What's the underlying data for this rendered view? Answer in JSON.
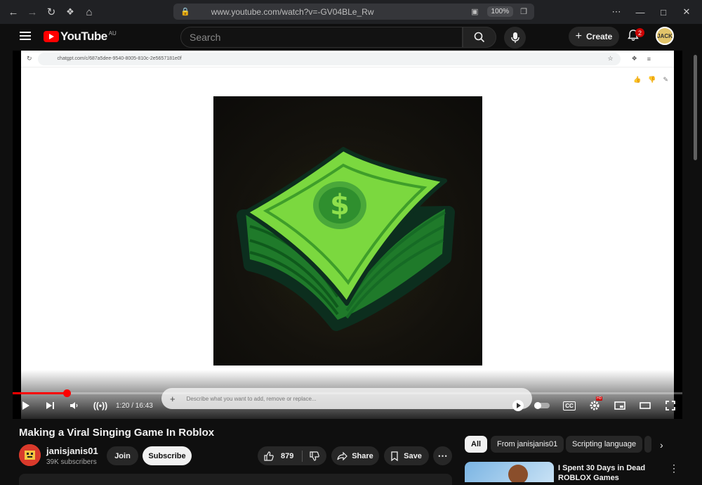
{
  "browser": {
    "url": "www.youtube.com/watch?v=-GV04BLe_Rw",
    "zoom": "100%",
    "back_icon": "arrow-left-icon",
    "forward_icon": "arrow-right-icon",
    "reload_icon": "reload-icon",
    "extensions_icon": "puzzle-icon",
    "home_icon": "home-icon"
  },
  "youtube": {
    "logo_text": "YouTube",
    "region": "AU",
    "search_placeholder": "Search",
    "create_label": "Create",
    "notification_count": "2",
    "avatar_text": "JACK",
    "brand_color": "#ff0000"
  },
  "inner_screenshot": {
    "url": "chatgpt.com/c/687a5dee-9540-8005-810c-2e5657181e0f",
    "prompt_placeholder": "Describe what you want to add, remove or replace..."
  },
  "player": {
    "progress": 0.0806,
    "time": "1:20 / 16:43",
    "hd_badge": "HD",
    "cc_label": "CC"
  },
  "video": {
    "title": "Making a Viral Singing Game In Roblox",
    "channel": "janisjanis01",
    "subscribers": "39K subscribers",
    "join_label": "Join",
    "subscribe_label": "Subscribe",
    "likes": "879",
    "share_label": "Share",
    "save_label": "Save"
  },
  "sidebar": {
    "chips": [
      "All",
      "From janisjanis01",
      "Scripting language"
    ],
    "recommendation_title": "I Spent 30 Days in Dead ROBLOX Games"
  }
}
